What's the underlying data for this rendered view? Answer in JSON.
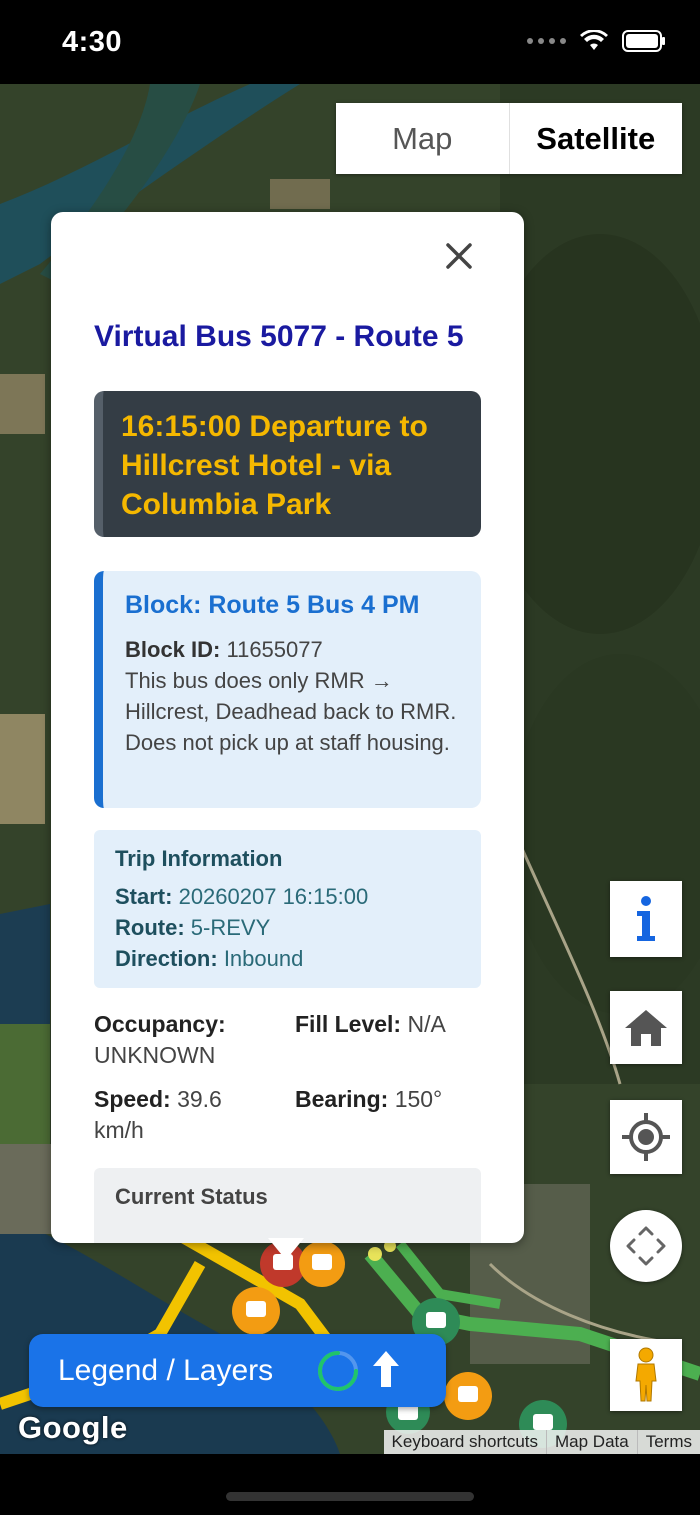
{
  "status_bar": {
    "time": "4:30"
  },
  "map_type": {
    "map_label": "Map",
    "satellite_label": "Satellite",
    "selected": "Satellite"
  },
  "info_window": {
    "title": "Virtual Bus 5077 - Route 5",
    "departure": "16:15:00 Departure to Hillcrest Hotel - via Columbia Park",
    "block": {
      "title": "Block: Route 5 Bus 4 PM",
      "id_label": "Block ID:",
      "id_value": "11655077",
      "description": "This bus does only RMR → Hillcrest, Deadhead back to RMR. Does not pick up at staff housing."
    },
    "trip": {
      "title": "Trip Information",
      "start_label": "Start:",
      "start_value": "20260207 16:15:00",
      "route_label": "Route:",
      "route_value": "5-REVY",
      "direction_label": "Direction:",
      "direction_value": "Inbound"
    },
    "stats": {
      "occupancy_label": "Occupancy:",
      "occupancy_value": "UNKNOWN",
      "fill_label": "Fill Level:",
      "fill_value": "N/A",
      "speed_label": "Speed:",
      "speed_value": "39.6 km/h",
      "bearing_label": "Bearing:",
      "bearing_value": "150°"
    },
    "current_status_title": "Current Status"
  },
  "side_controls": [
    "info-icon",
    "home-icon",
    "my-location-icon",
    "recenter-icon",
    "street-view-pegman-icon"
  ],
  "legend_button": {
    "label": "Legend / Layers"
  },
  "map_footer": {
    "logo": "Google",
    "links": [
      "Keyboard shortcuts",
      "Map Data",
      "Terms"
    ]
  },
  "colors": {
    "title_blue": "#1a1aa0",
    "departure_bg": "#343d45",
    "departure_text": "#f5b800",
    "block_accent": "#1a6fd0",
    "legend_button": "#1a73e8",
    "route_yellow": "#f2c300",
    "route_green": "#4caf50"
  }
}
